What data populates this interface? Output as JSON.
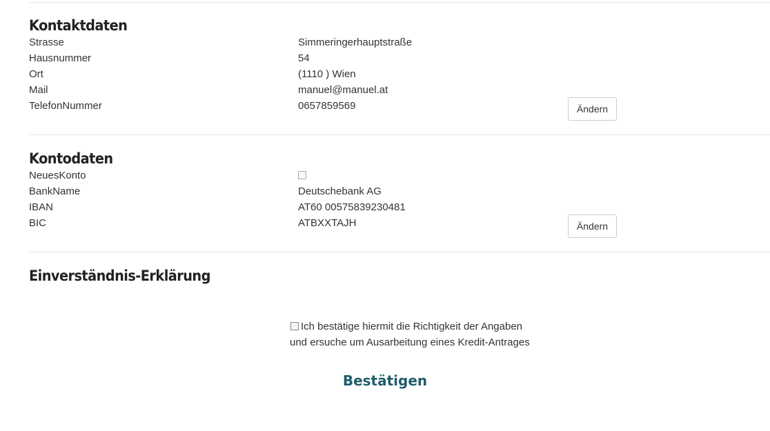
{
  "contact": {
    "title": "Kontaktdaten",
    "rows": [
      {
        "label": "Strasse",
        "value": "Simmeringerhauptstraße"
      },
      {
        "label": "Hausnummer",
        "value": "54"
      },
      {
        "label": "Ort",
        "value": "(1110 ) Wien"
      },
      {
        "label": "Mail",
        "value": "manuel@manuel.at"
      },
      {
        "label": "TelefonNummer",
        "value": "0657859569"
      }
    ],
    "edit_label": "Ändern"
  },
  "account": {
    "title": "Kontodaten",
    "new_account_label": "NeuesKonto",
    "new_account_checked": false,
    "rows": [
      {
        "label": "BankName",
        "value": "Deutschebank AG"
      },
      {
        "label": "IBAN",
        "value": "AT60 00575839230481"
      },
      {
        "label": "BIC",
        "value": "ATBXXTAJH"
      }
    ],
    "edit_label": "Ändern"
  },
  "consent": {
    "title": "Einverständnis-Erklärung",
    "checked": false,
    "text_line1": "Ich bestätige hiermit die Richtigkeit der Angaben",
    "text_line2": "und ersuche um Ausarbeitung eines Kredit-Antrages"
  },
  "confirm_label": "Bestätigen",
  "colors": {
    "confirm_text": "#1f5d6b",
    "divider": "#e8e8e8"
  }
}
